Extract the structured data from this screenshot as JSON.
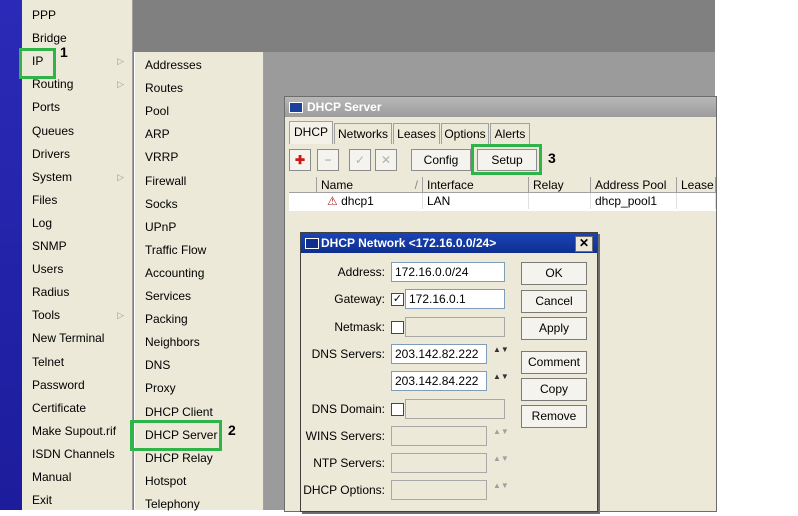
{
  "main_menu": [
    {
      "label": "PPP"
    },
    {
      "label": "Bridge"
    },
    {
      "label": "IP",
      "submenu": true
    },
    {
      "label": "Routing",
      "submenu": true
    },
    {
      "label": "Ports"
    },
    {
      "label": "Queues"
    },
    {
      "label": "Drivers"
    },
    {
      "label": "System",
      "submenu": true
    },
    {
      "label": "Files"
    },
    {
      "label": "Log"
    },
    {
      "label": "SNMP"
    },
    {
      "label": "Users"
    },
    {
      "label": "Radius"
    },
    {
      "label": "Tools",
      "submenu": true
    },
    {
      "label": "New Terminal"
    },
    {
      "label": "Telnet"
    },
    {
      "label": "Password"
    },
    {
      "label": "Certificate"
    },
    {
      "label": "Make Supout.rif"
    },
    {
      "label": "ISDN Channels"
    },
    {
      "label": "Manual"
    },
    {
      "label": "Exit"
    }
  ],
  "submenu_arrow": "▷",
  "ip_submenu": [
    "Addresses",
    "Routes",
    "Pool",
    "ARP",
    "VRRP",
    "Firewall",
    "Socks",
    "UPnP",
    "Traffic Flow",
    "Accounting",
    "Services",
    "Packing",
    "Neighbors",
    "DNS",
    "Proxy",
    "DHCP Client",
    "DHCP Server",
    "DHCP Relay",
    "Hotspot",
    "Telephony"
  ],
  "annotations": {
    "n1": "1",
    "n2": "2",
    "n3": "3",
    "highlight_color": "#2fb44a"
  },
  "dhcp_window": {
    "title": "DHCP Server",
    "tabs": [
      "DHCP",
      "Networks",
      "Leases",
      "Options",
      "Alerts"
    ],
    "toolbar": {
      "add": "✚",
      "remove": "−",
      "enable": "✓",
      "disable": "✕",
      "config": "Config",
      "setup": "Setup"
    },
    "columns": [
      "Name",
      "Interface",
      "Relay",
      "Address Pool",
      "Lease T"
    ],
    "sort_glyph": "/",
    "rows": [
      {
        "flag": "⚠",
        "name": "dhcp1",
        "interface": "LAN",
        "relay": "",
        "pool": "dhcp_pool1",
        "lease": ""
      }
    ]
  },
  "network_dialog": {
    "title": "DHCP Network <172.16.0.0/24>",
    "close": "✕",
    "labels": {
      "address": "Address:",
      "gateway": "Gateway:",
      "netmask": "Netmask:",
      "dns": "DNS Servers:",
      "dns_domain": "DNS Domain:",
      "wins": "WINS Servers:",
      "ntp": "NTP Servers:",
      "dhcp_options": "DHCP Options:"
    },
    "values": {
      "address": "172.16.0.0/24",
      "gateway": "172.16.0.1",
      "dns1": "203.142.82.222",
      "dns2": "203.142.84.222"
    },
    "checks": {
      "gateway": "✓"
    },
    "spinner": "▲▼",
    "buttons": {
      "ok": "OK",
      "cancel": "Cancel",
      "apply": "Apply",
      "comment": "Comment",
      "copy": "Copy",
      "remove": "Remove"
    }
  }
}
